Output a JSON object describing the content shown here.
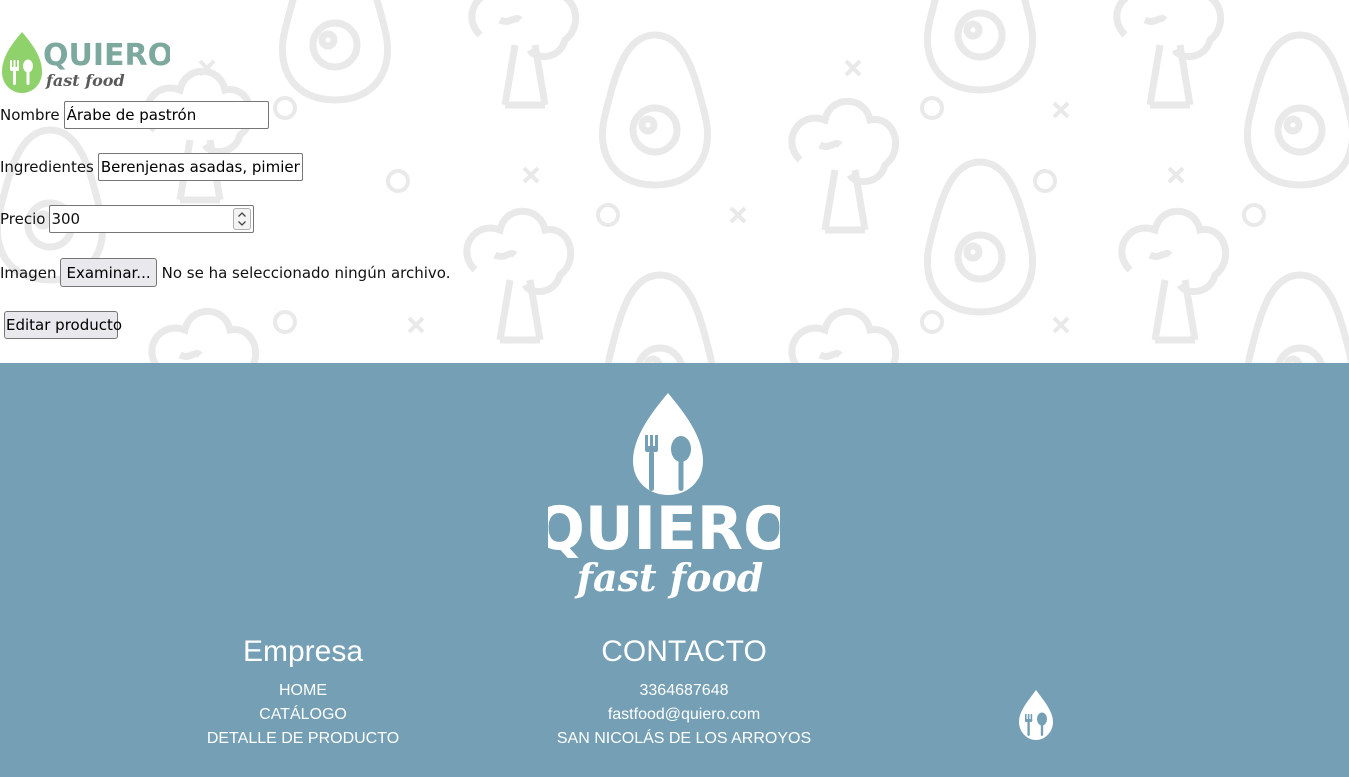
{
  "brand": {
    "name": "QUIERO",
    "tagline": "fast food"
  },
  "form": {
    "nombre_label": "Nombre",
    "nombre_value": "Árabe de pastrón",
    "ingredientes_label": "Ingredientes",
    "ingredientes_value": "Berenjenas asadas, pimientos",
    "precio_label": "Precio",
    "precio_value": "300",
    "imagen_label": "Imagen",
    "file_button_label": "Examinar...",
    "file_status": "No se ha seleccionado ningún archivo.",
    "submit_label": "Editar producto"
  },
  "footer": {
    "empresa": {
      "title": "Empresa",
      "links": [
        "HOME",
        "CATÁLOGO",
        "DETALLE DE PRODUCTO"
      ]
    },
    "contacto": {
      "title": "CONTACTO",
      "items": [
        "3364687648",
        "fastfood@quiero.com",
        "SAN NICOLÁS DE LOS ARROYOS"
      ]
    }
  },
  "colors": {
    "footer_bg": "#749fb4",
    "logo_green": "#8fd16a",
    "logo_teal": "#7da89e",
    "pattern": "#e8e8e8"
  },
  "icons": [
    "food-pattern",
    "quiero-logo-icon",
    "fork-spoon-drop-icon",
    "spinner-icon"
  ]
}
